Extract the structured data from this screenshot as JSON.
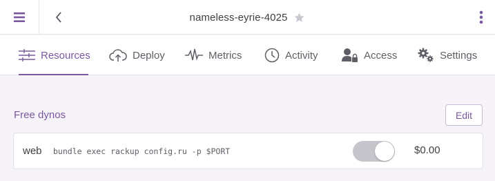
{
  "topbar": {
    "app_name": "nameless-eyrie-4025",
    "menu_icon": "hamburger-icon",
    "back_icon": "chevron-left-icon",
    "favorite_icon": "star-icon",
    "more_icon": "kebab-icon"
  },
  "tabs": [
    {
      "label": "Resources",
      "icon": "sliders-icon",
      "active": true
    },
    {
      "label": "Deploy",
      "icon": "cloud-upload-icon",
      "active": false
    },
    {
      "label": "Metrics",
      "icon": "pulse-icon",
      "active": false
    },
    {
      "label": "Activity",
      "icon": "clock-icon",
      "active": false
    },
    {
      "label": "Access",
      "icon": "user-lock-icon",
      "active": false
    },
    {
      "label": "Settings",
      "icon": "gears-icon",
      "active": false
    }
  ],
  "free_dynos": {
    "title": "Free dynos",
    "edit_label": "Edit",
    "dynos": [
      {
        "name": "web",
        "command": "bundle exec rackup config.ru -p $PORT",
        "enabled": true,
        "price": "$0.00"
      }
    ]
  },
  "colors": {
    "accent": "#79589f",
    "background": "#f6f4f8",
    "toggle_track": "#c7c5cc",
    "text": "#3f3f44"
  }
}
